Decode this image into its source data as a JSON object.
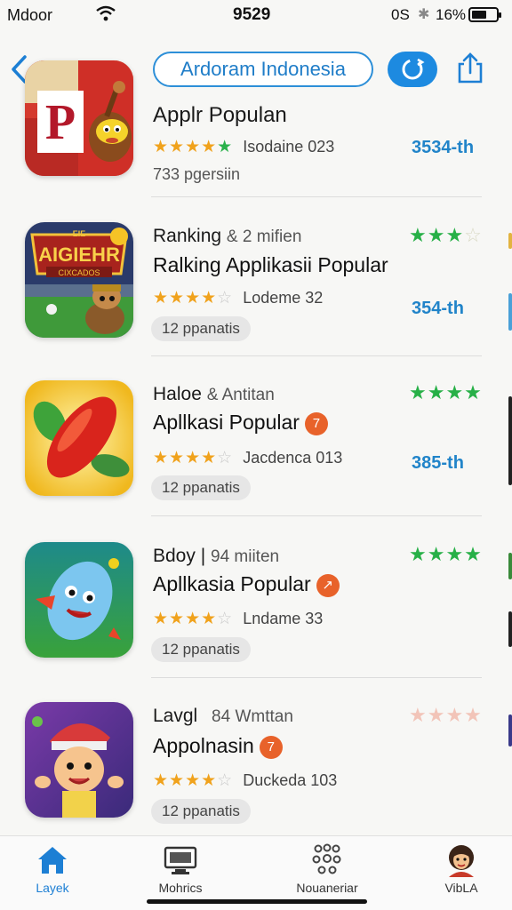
{
  "status_bar": {
    "carrier": "Mdoor",
    "time": "9529",
    "right_label": "0S",
    "battery_percent": "16%"
  },
  "header": {
    "search_text": "Ardoram Indonesia",
    "back_icon": "chevron-left-icon",
    "action_icon": "refresh-icon",
    "share_icon": "share-icon"
  },
  "apps": [
    {
      "line1_name": "Applr",
      "line1_sub": "",
      "line2": "Populan",
      "rating_text": "Isodaine 023",
      "rating_stars": 5,
      "stars_style": "mixed",
      "rank": "3534-th",
      "extra": "733 pgersiin",
      "chip": "",
      "top_stars_filled": 0,
      "has_badge": false
    },
    {
      "line1_name": "Ranking",
      "line1_sub": "& 2 mifien",
      "line2": "Ralking Applikasii Popular",
      "rating_text": "Lodeme 32",
      "rating_stars": 4,
      "stars_style": "orange",
      "rank": "354-th",
      "extra": "",
      "chip": "12 ppanatis",
      "top_stars_filled": 3,
      "has_badge": false
    },
    {
      "line1_name": "Haloe",
      "line1_sub": "& Antitan",
      "line2": "Apllkasi Popular",
      "rating_text": "Jacdenca 013",
      "rating_stars": 4,
      "stars_style": "orange",
      "rank": "385-th",
      "extra": "",
      "chip": "12 ppanatis",
      "top_stars_filled": 4,
      "has_badge": true,
      "badge_glyph": "7"
    },
    {
      "line1_name": "Bdoy |",
      "line1_sub": "94 miiten",
      "line2": "Apllkasia Popular",
      "rating_text": "Lndame 33",
      "rating_stars": 4,
      "stars_style": "orange",
      "rank": "",
      "extra": "",
      "chip": "12 ppanatis",
      "top_stars_filled": 4,
      "has_badge": true,
      "badge_glyph": "↗"
    },
    {
      "line1_name": "Lavgl",
      "line1_sub": "84 Wmttan",
      "line2": "Appolnasin",
      "rating_text": "Duckeda 103",
      "rating_stars": 4,
      "stars_style": "orange",
      "rank": "",
      "extra": "",
      "chip": "12 ppanatis",
      "top_stars_filled": 4,
      "top_stars_faded": true,
      "has_badge": true,
      "badge_glyph": "7"
    }
  ],
  "icon_text": {
    "app1": "P",
    "app2_title": "AIGIEHR",
    "app2_banner": "CIXCADOS",
    "app2_top": "EIE"
  },
  "tabbar": {
    "tabs": [
      {
        "label": "Layek",
        "icon": "home-icon",
        "active": true
      },
      {
        "label": "Mohrics",
        "icon": "monitor-icon",
        "active": false
      },
      {
        "label": "Nouaneriar",
        "icon": "dots-cluster-icon",
        "active": false
      },
      {
        "label": "VibLA",
        "icon": "avatar-icon",
        "active": false
      }
    ]
  },
  "colors": {
    "accent": "#1d8ae0",
    "rank_blue": "#2184c9",
    "star_orange": "#f0a21c",
    "star_green": "#2bb24c",
    "badge_orange": "#e8622a"
  }
}
